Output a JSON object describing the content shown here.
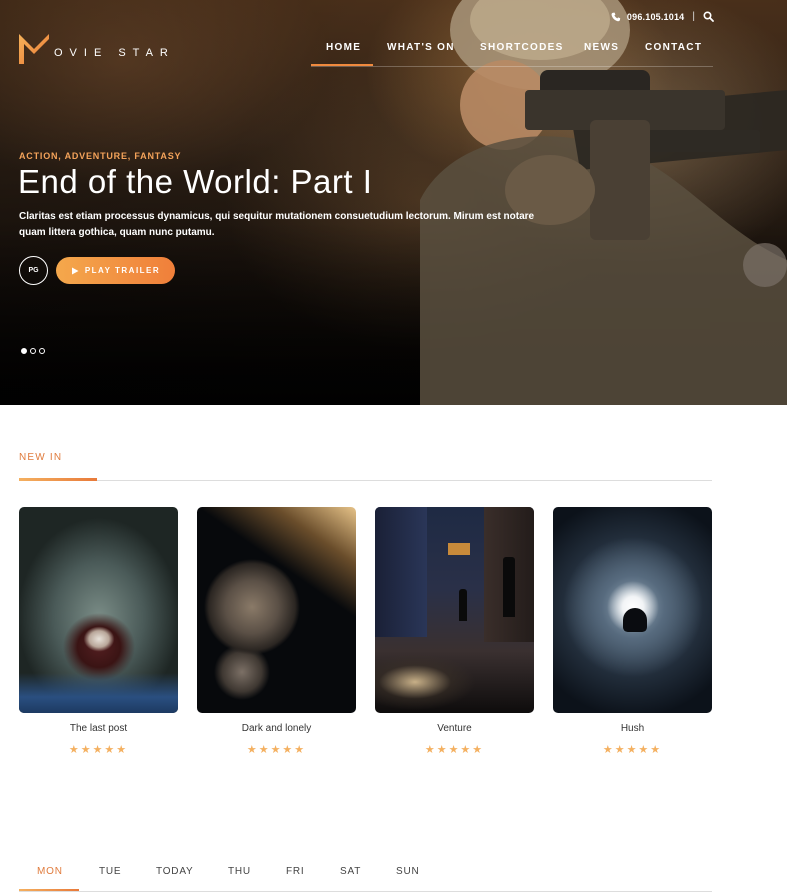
{
  "header": {
    "logo_letter": "M",
    "logo_text": "OVIE STAR",
    "phone": "096.105.1014",
    "separator": "|",
    "nav": [
      {
        "label": "HOME"
      },
      {
        "label": "WHAT'S ON"
      },
      {
        "label": "SHORTCODES"
      },
      {
        "label": "NEWS"
      },
      {
        "label": "CONTACT"
      }
    ],
    "active_nav": "HOME",
    "icons": [
      "phone-icon",
      "search-icon"
    ]
  },
  "hero": {
    "genres": "ACTION, ADVENTURE, FANTASY",
    "title": "End of the World: Part I",
    "description": "Claritas est etiam processus dynamicus, qui sequitur mutationem consuetudium lectorum. Mirum est notare quam littera gothica, quam nunc putamu.",
    "rating": "PG",
    "play_label": "PLAY TRAILER",
    "slide_count": 3,
    "active_slide": 1
  },
  "new_in": {
    "heading": "NEW IN",
    "movies": [
      {
        "title": "The last post",
        "stars": "★★★★★"
      },
      {
        "title": "Dark and lonely",
        "stars": "★★★★★"
      },
      {
        "title": "Venture",
        "stars": "★★★★★"
      },
      {
        "title": "Hush",
        "stars": "★★★★★"
      }
    ]
  },
  "schedule": {
    "days": [
      "MON",
      "TUE",
      "TODAY",
      "THU",
      "FRI",
      "SAT",
      "SUN"
    ],
    "active_day": "MON"
  },
  "colors": {
    "accent": "#f08a3e",
    "star": "#f4b060"
  }
}
